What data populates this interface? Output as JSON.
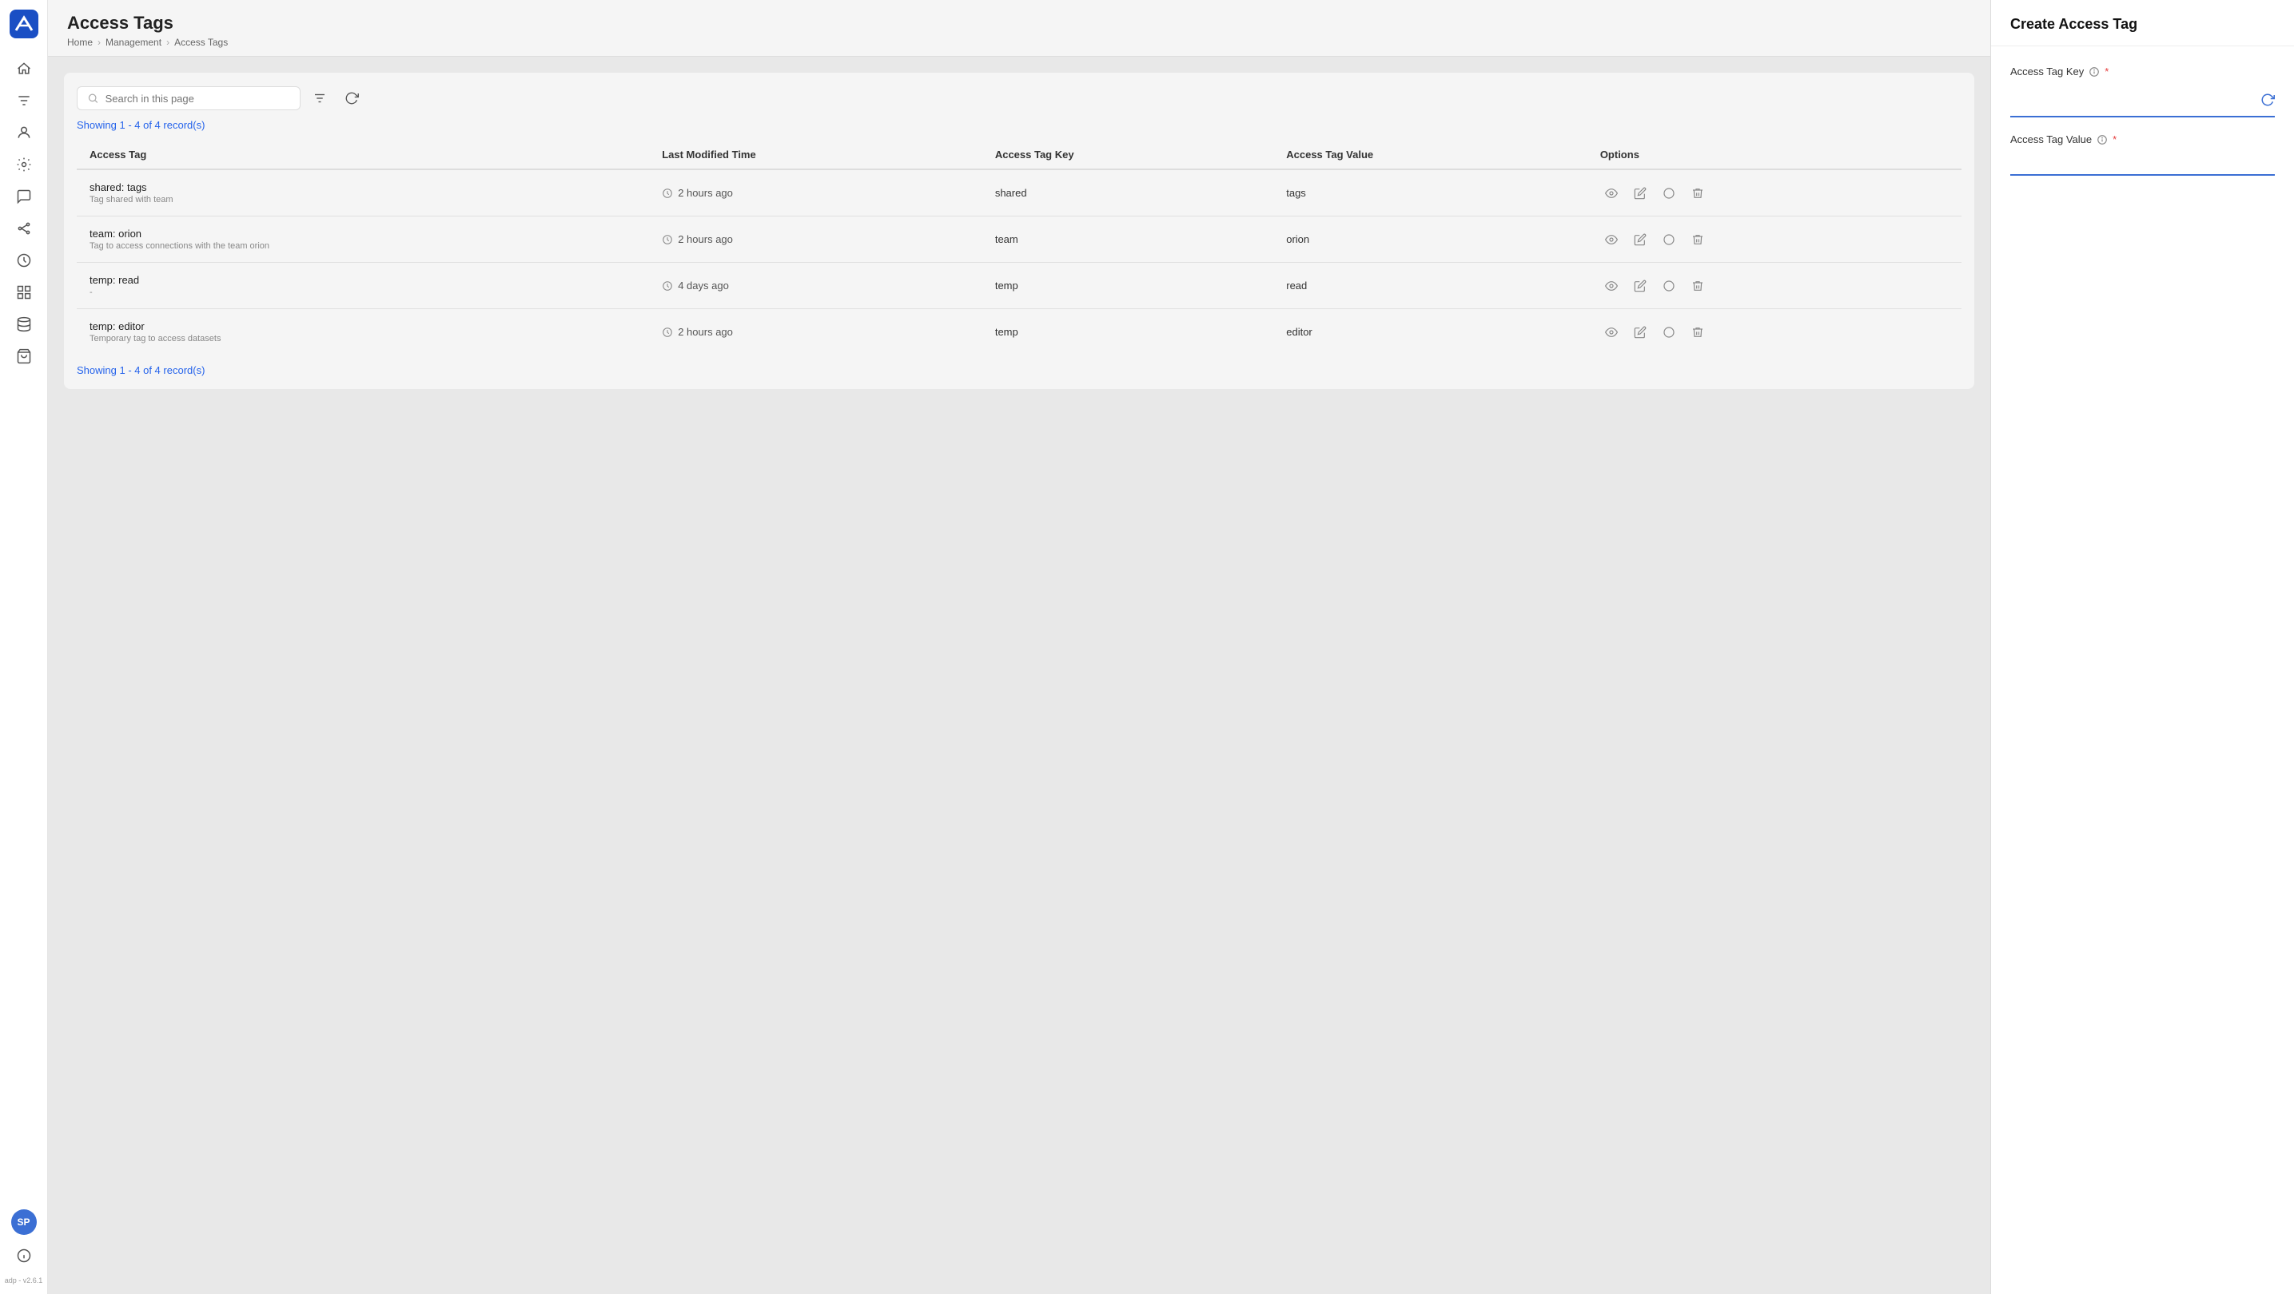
{
  "app": {
    "version": "adp - v2.6.1",
    "logo_initials": "A"
  },
  "sidebar": {
    "avatar_initials": "SP",
    "icons": [
      {
        "name": "home-icon",
        "symbol": "⌂"
      },
      {
        "name": "filter-icon",
        "symbol": "⚡"
      },
      {
        "name": "users-icon",
        "symbol": "👤"
      },
      {
        "name": "settings-icon",
        "symbol": "⚙"
      },
      {
        "name": "chat-icon",
        "symbol": "💬"
      },
      {
        "name": "connections-icon",
        "symbol": "🔗"
      },
      {
        "name": "clock-icon",
        "symbol": "🕐"
      },
      {
        "name": "grid-icon",
        "symbol": "⊞"
      },
      {
        "name": "database-icon",
        "symbol": "🗄"
      },
      {
        "name": "bag-icon",
        "symbol": "💼"
      }
    ]
  },
  "page": {
    "title": "Access Tags",
    "breadcrumb": [
      "Home",
      "Management",
      "Access Tags"
    ]
  },
  "toolbar": {
    "search_placeholder": "Search in this page"
  },
  "table": {
    "records_label": "Showing 1 - 4 of 4 record(s)",
    "columns": [
      "Access Tag",
      "Last Modified Time",
      "Access Tag Key",
      "Access Tag Value",
      "Options"
    ],
    "rows": [
      {
        "name": "shared: tags",
        "description": "Tag shared with team",
        "modified": "2 hours ago",
        "key": "shared",
        "value": "tags"
      },
      {
        "name": "team: orion",
        "description": "Tag to access connections with the team orion",
        "modified": "2 hours ago",
        "key": "team",
        "value": "orion"
      },
      {
        "name": "temp: read",
        "description": "-",
        "modified": "4 days ago",
        "key": "temp",
        "value": "read"
      },
      {
        "name": "temp: editor",
        "description": "Temporary tag to access datasets",
        "modified": "2 hours ago",
        "key": "temp",
        "value": "editor"
      }
    ]
  },
  "create_panel": {
    "title": "Create Access Tag",
    "key_label": "Access Tag Key",
    "key_placeholder": "",
    "value_label": "Access Tag Value",
    "value_placeholder": ""
  }
}
